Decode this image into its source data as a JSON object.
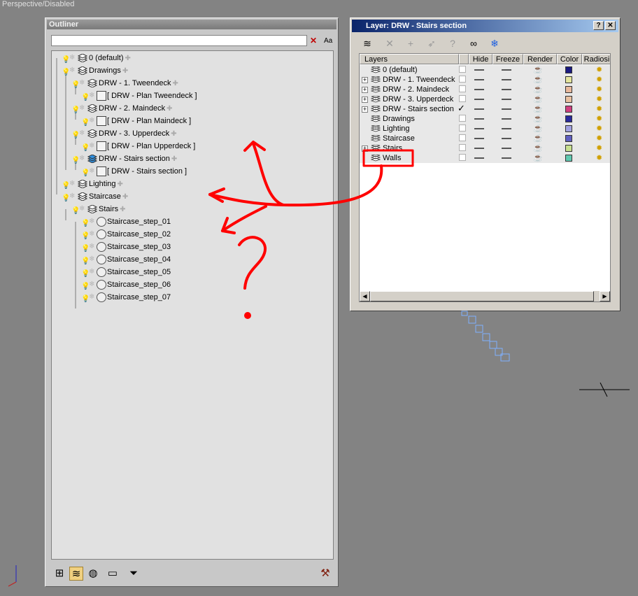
{
  "viewport": {
    "label": "Perspective/Disabled"
  },
  "outliner": {
    "title": "Outliner",
    "search": {
      "value": "",
      "placeholder": ""
    },
    "clear_label": "✕",
    "case_label": "Aa",
    "tree": [
      {
        "label": "0 (default)",
        "kind": "layer"
      },
      {
        "label": "Drawings",
        "kind": "layer"
      },
      {
        "label": "DRW - 1. Tweendeck",
        "kind": "layer"
      },
      {
        "label": "[ DRW - Plan Tweendeck ]",
        "kind": "object"
      },
      {
        "label": "DRW - 2. Maindeck",
        "kind": "layer"
      },
      {
        "label": "[ DRW - Plan Maindeck ]",
        "kind": "object"
      },
      {
        "label": "DRW - 3. Upperdeck",
        "kind": "layer"
      },
      {
        "label": "[ DRW - Plan Upperdeck ]",
        "kind": "object"
      },
      {
        "label": "DRW - Stairs section",
        "kind": "layer-active"
      },
      {
        "label": "[ DRW - Stairs section ]",
        "kind": "object"
      },
      {
        "label": "Lighting",
        "kind": "layer"
      },
      {
        "label": "Staircase",
        "kind": "layer"
      },
      {
        "label": "Stairs",
        "kind": "layer"
      },
      {
        "label": "Staircase_step_01",
        "kind": "sphere"
      },
      {
        "label": "Staircase_step_02",
        "kind": "sphere"
      },
      {
        "label": "Staircase_step_03",
        "kind": "sphere"
      },
      {
        "label": "Staircase_step_04",
        "kind": "sphere"
      },
      {
        "label": "Staircase_step_05",
        "kind": "sphere"
      },
      {
        "label": "Staircase_step_06",
        "kind": "sphere"
      },
      {
        "label": "Staircase_step_07",
        "kind": "sphere"
      }
    ],
    "toolbar_icons": [
      "hierarchy-icon",
      "layers-icon",
      "materials-icon",
      "rename-icon",
      "filter-icon",
      "hammer-icon"
    ]
  },
  "layer_dialog": {
    "title": "Layer: DRW - Stairs section",
    "help_label": "?",
    "close_label": "✕",
    "columns": [
      "Layers",
      "Hide",
      "Freeze",
      "Render",
      "Color",
      "Radiosi"
    ],
    "rows": [
      {
        "name": "0 (default)",
        "expandable": false,
        "active": false,
        "color": "#1a1a80"
      },
      {
        "name": "DRW - 1. Tweendeck",
        "expandable": true,
        "active": false,
        "color": "#e4e49c"
      },
      {
        "name": "DRW - 2. Maindeck",
        "expandable": true,
        "active": false,
        "color": "#e8b89c"
      },
      {
        "name": "DRW - 3. Upperdeck",
        "expandable": true,
        "active": false,
        "color": "#e8c0a0"
      },
      {
        "name": "DRW - Stairs section",
        "expandable": true,
        "active": true,
        "color": "#d04080"
      },
      {
        "name": "Drawings",
        "expandable": false,
        "active": false,
        "color": "#2a2a9c"
      },
      {
        "name": "Lighting",
        "expandable": false,
        "active": false,
        "color": "#a0a0e0"
      },
      {
        "name": "Staircase",
        "expandable": false,
        "active": false,
        "color": "#6060c0"
      },
      {
        "name": "Stairs",
        "expandable": true,
        "active": false,
        "color": "#c8e090"
      },
      {
        "name": "Walls",
        "expandable": false,
        "active": false,
        "color": "#60c8b0"
      }
    ],
    "toolbar_icons": [
      "new-layer-icon",
      "delete-icon",
      "add-icon",
      "select-icon",
      "help-icon",
      "hide-all-icon",
      "freeze-all-icon"
    ]
  },
  "colors": {
    "annotation": "#ff0000",
    "title_active": "#0a246a"
  }
}
